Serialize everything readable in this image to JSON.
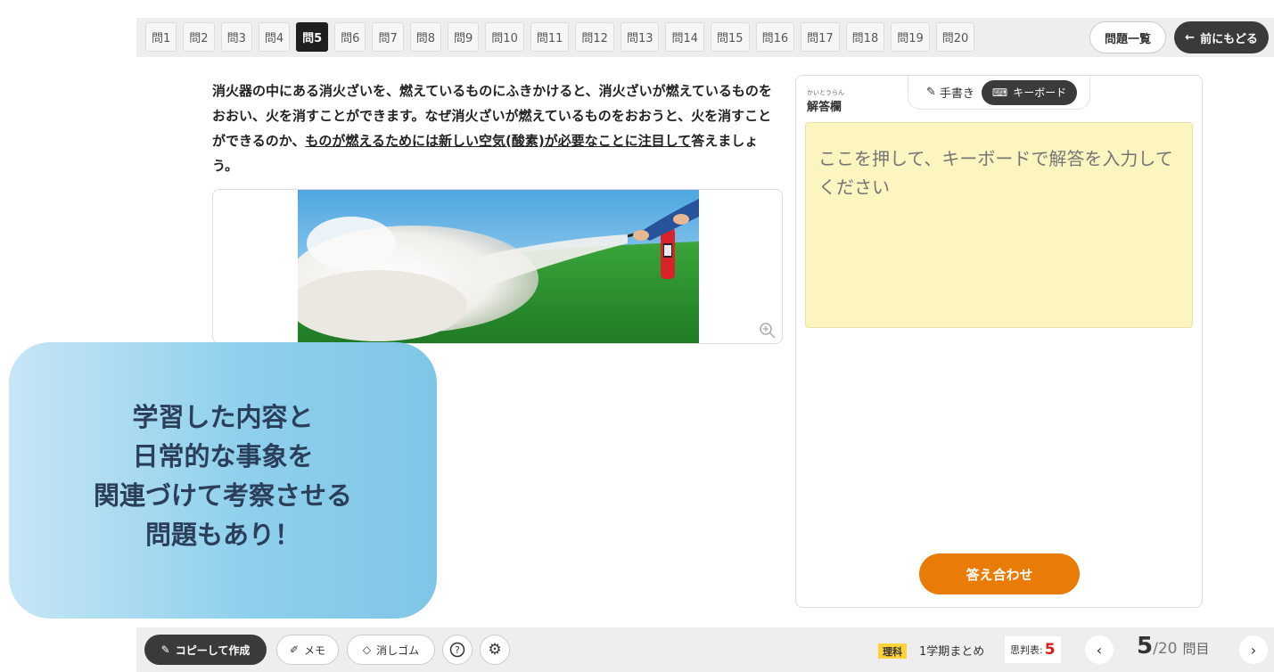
{
  "tabs": [
    {
      "label": "問1"
    },
    {
      "label": "問2"
    },
    {
      "label": "問3"
    },
    {
      "label": "問4"
    },
    {
      "label": "問5",
      "active": true
    },
    {
      "label": "問6"
    },
    {
      "label": "問7"
    },
    {
      "label": "問8"
    },
    {
      "label": "問9"
    },
    {
      "label": "問10"
    },
    {
      "label": "問11"
    },
    {
      "label": "問12"
    },
    {
      "label": "問13"
    },
    {
      "label": "問14"
    },
    {
      "label": "問15"
    },
    {
      "label": "問16"
    },
    {
      "label": "問17"
    },
    {
      "label": "問18"
    },
    {
      "label": "問19"
    },
    {
      "label": "問20"
    }
  ],
  "header": {
    "list_label": "問題一覧",
    "back_label": "前にもどる"
  },
  "question": {
    "text_before": "消火器の中にある消火ざいを、燃えているものにふきかけると、消火ざいが燃えているものをおおい、火を消すことができます。なぜ消火ざいが燃えているものをおおうと、火を消すことができるのか、",
    "text_underlined": "ものが燃えるためには新しい空気(酸素)が必要なことに注目して",
    "text_after": "答えましょう。"
  },
  "answer": {
    "title_ruby": "かいとうらん",
    "title": "解答欄",
    "mode_handwriting": "手書き",
    "mode_keyboard": "キーボード",
    "placeholder": "ここを押して、キーボードで解答を入力してください",
    "check_label": "答え合わせ"
  },
  "promo": {
    "line1": "学習した内容と",
    "line2": "日常的な事象を",
    "line3": "関連づけて考察させる",
    "line4": "問題もあり！"
  },
  "toolbar": {
    "copy_label": "コピーして作成",
    "memo_label": "メモ",
    "eraser_label": "消しゴム",
    "help_icon": "question-icon",
    "settings_icon": "gear-icon",
    "subject": "理科",
    "unit": "1学期まとめ",
    "shihan_label": "思判表:",
    "shihan_value": "5",
    "page_current": "5",
    "page_total": "/20",
    "page_suffix": "問目"
  },
  "colors": {
    "accent_orange": "#e87c06",
    "answer_bg": "#fdf5c0",
    "dark": "#3a3a3a",
    "subject_badge": "#ffd23a",
    "promo_blue": "#8fd0ec"
  }
}
